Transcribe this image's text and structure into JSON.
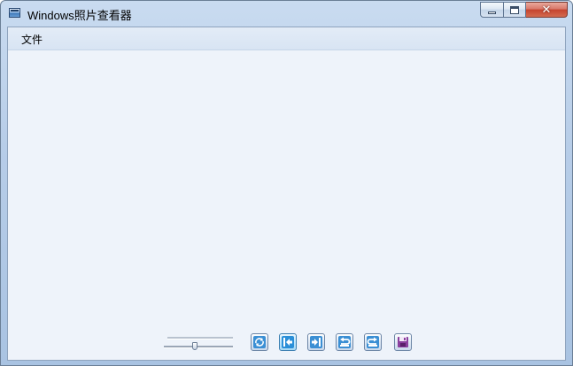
{
  "window": {
    "title": "Windows照片查看器",
    "close_glyph": "✕"
  },
  "menu": {
    "file": "文件"
  },
  "toolbar": {
    "zoom_level": 0.45,
    "buttons": [
      {
        "name": "actual-size-button",
        "icon": "refresh-arrows-icon"
      },
      {
        "name": "previous-button",
        "icon": "previous-icon"
      },
      {
        "name": "next-button",
        "icon": "next-icon"
      },
      {
        "name": "rotate-counterclockwise-button",
        "icon": "rotate-ccw-icon"
      },
      {
        "name": "rotate-clockwise-button",
        "icon": "rotate-cw-icon"
      },
      {
        "name": "delete-button",
        "icon": "save-disk-icon"
      }
    ]
  },
  "colors": {
    "accent": "#2a8fd8",
    "titlebar": "#b7cde8",
    "client_bg": "#eef3fa",
    "close_button": "#c5432e"
  }
}
